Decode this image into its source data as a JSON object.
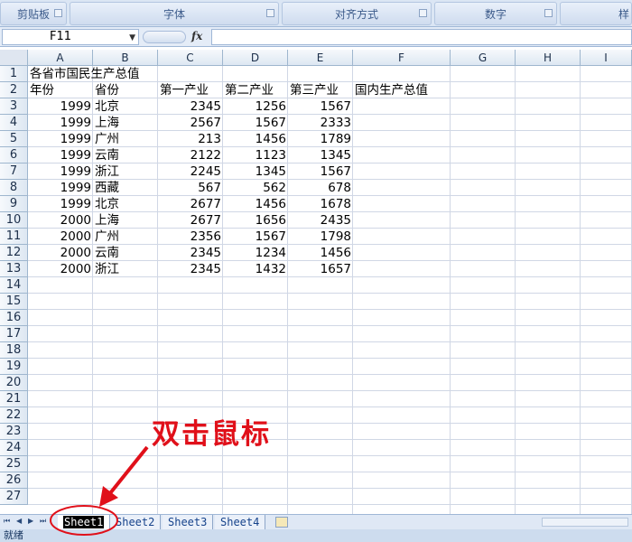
{
  "ribbon": {
    "groups": [
      {
        "label": "剪贴板"
      },
      {
        "label": "字体"
      },
      {
        "label": "对齐方式"
      },
      {
        "label": "数字"
      },
      {
        "label": "样"
      }
    ]
  },
  "formula_bar": {
    "name_box": "F11",
    "fx_label": "fx",
    "value": ""
  },
  "columns": [
    "A",
    "B",
    "C",
    "D",
    "E",
    "F",
    "G",
    "H",
    "I"
  ],
  "rows": [
    "1",
    "2",
    "3",
    "4",
    "5",
    "6",
    "7",
    "8",
    "9",
    "10",
    "11",
    "12",
    "13",
    "14",
    "15",
    "16",
    "17",
    "18",
    "19",
    "20",
    "21",
    "22",
    "23",
    "24",
    "25",
    "26",
    "27"
  ],
  "sheet": {
    "title": "各省市国民生产总值",
    "headers": [
      "年份",
      "省份",
      "第一产业",
      "第二产业",
      "第三产业",
      "国内生产总值"
    ],
    "data": [
      [
        "1999",
        "北京",
        "2345",
        "1256",
        "1567"
      ],
      [
        "1999",
        "上海",
        "2567",
        "1567",
        "2333"
      ],
      [
        "1999",
        "广州",
        "213",
        "1456",
        "1789"
      ],
      [
        "1999",
        "云南",
        "2122",
        "1123",
        "1345"
      ],
      [
        "1999",
        "浙江",
        "2245",
        "1345",
        "1567"
      ],
      [
        "1999",
        "西藏",
        "567",
        "562",
        "678"
      ],
      [
        "1999",
        "北京",
        "2677",
        "1456",
        "1678"
      ],
      [
        "2000",
        "上海",
        "2677",
        "1656",
        "2435"
      ],
      [
        "2000",
        "广州",
        "2356",
        "1567",
        "1798"
      ],
      [
        "2000",
        "云南",
        "2345",
        "1234",
        "1456"
      ],
      [
        "2000",
        "浙江",
        "2345",
        "1432",
        "1657"
      ]
    ]
  },
  "tabs": [
    {
      "label": "Sheet1",
      "active": true
    },
    {
      "label": "Sheet2",
      "active": false
    },
    {
      "label": "Sheet3",
      "active": false
    },
    {
      "label": "Sheet4",
      "active": false
    }
  ],
  "status_bar": {
    "text": "就绪"
  },
  "annotation": {
    "text": "双击鼠标",
    "color": "#e0101a"
  }
}
